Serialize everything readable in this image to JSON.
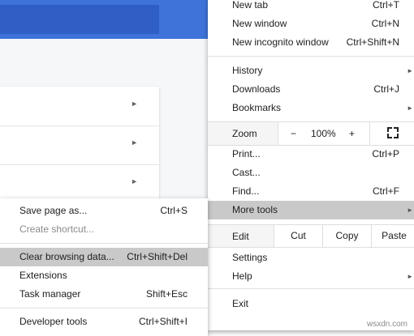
{
  "main_menu": {
    "new_tab": {
      "label": "New tab",
      "shortcut": "Ctrl+T"
    },
    "new_window": {
      "label": "New window",
      "shortcut": "Ctrl+N"
    },
    "new_incognito": {
      "label": "New incognito window",
      "shortcut": "Ctrl+Shift+N"
    },
    "history": {
      "label": "History"
    },
    "downloads": {
      "label": "Downloads",
      "shortcut": "Ctrl+J"
    },
    "bookmarks": {
      "label": "Bookmarks"
    },
    "zoom": {
      "label": "Zoom",
      "minus": "−",
      "level": "100%",
      "plus": "+"
    },
    "print": {
      "label": "Print...",
      "shortcut": "Ctrl+P"
    },
    "cast": {
      "label": "Cast..."
    },
    "find": {
      "label": "Find...",
      "shortcut": "Ctrl+F"
    },
    "more_tools": {
      "label": "More tools"
    },
    "edit": {
      "label": "Edit",
      "cut": "Cut",
      "copy": "Copy",
      "paste": "Paste"
    },
    "settings": {
      "label": "Settings"
    },
    "help": {
      "label": "Help"
    },
    "exit": {
      "label": "Exit"
    }
  },
  "sub_menu": {
    "save_page": {
      "label": "Save page as...",
      "shortcut": "Ctrl+S"
    },
    "create_shortcut": {
      "label": "Create shortcut..."
    },
    "clear_browsing": {
      "label": "Clear browsing data...",
      "shortcut": "Ctrl+Shift+Del"
    },
    "extensions": {
      "label": "Extensions"
    },
    "task_manager": {
      "label": "Task manager",
      "shortcut": "Shift+Esc"
    },
    "developer_tools": {
      "label": "Developer tools",
      "shortcut": "Ctrl+Shift+I"
    }
  },
  "watermark": "wsxdn.com",
  "colors": {
    "header": "#3f73d9",
    "highlight": "#c9c9c9"
  }
}
